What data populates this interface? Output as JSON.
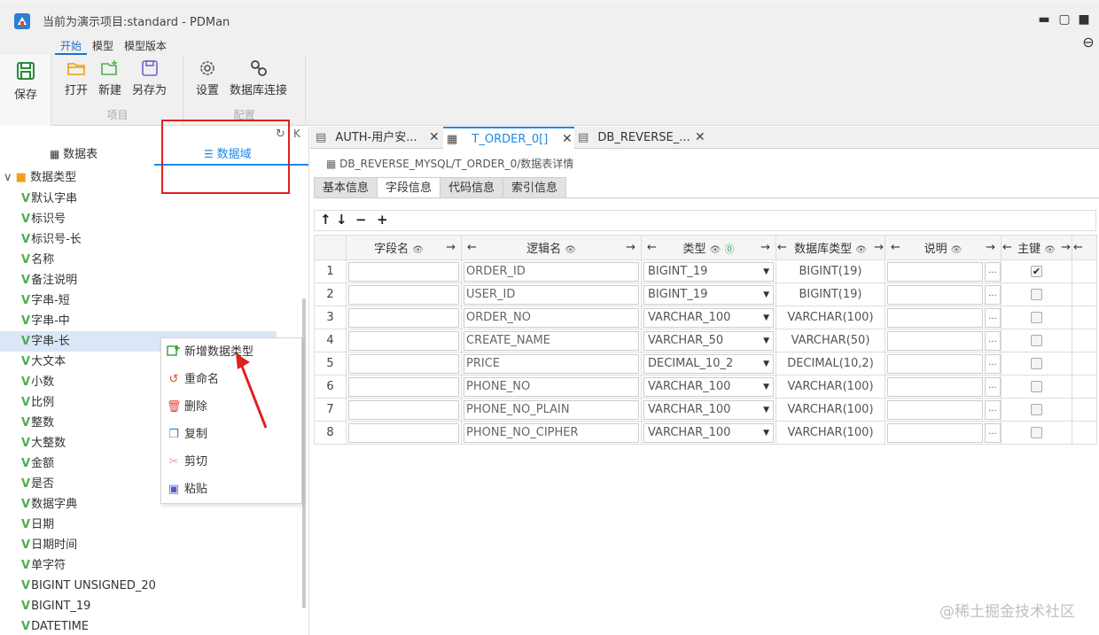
{
  "window": {
    "title": "当前为演示项目:standard - PDMan",
    "minimize": "▬",
    "maximize": "▢",
    "close": "■",
    "logout": "⊖"
  },
  "ribbon": {
    "tabs": [
      {
        "label": "开始",
        "active": true
      },
      {
        "label": "模型"
      },
      {
        "label": "模型版本"
      }
    ],
    "save": {
      "label": "保存",
      "icon": "save-icon"
    },
    "project_group": {
      "label": "项目",
      "buttons": [
        {
          "label": "打开",
          "icon": "folder-open-icon"
        },
        {
          "label": "新建",
          "icon": "new-file-icon"
        },
        {
          "label": "另存为",
          "icon": "save-as-icon"
        }
      ]
    },
    "config_group": {
      "label": "配置",
      "buttons": [
        {
          "label": "设置",
          "icon": "gear-icon"
        },
        {
          "label": "数据库连接",
          "icon": "link-icon"
        }
      ]
    }
  },
  "left_panel": {
    "tabs": [
      {
        "label": "数据表",
        "icon": "grid-icon"
      },
      {
        "label": "数据域",
        "icon": "list-icon",
        "active": true
      }
    ],
    "tree_root": "数据类型",
    "tree_items": [
      "默认字串",
      "标识号",
      "标识号-长",
      "名称",
      "备注说明",
      "字串-短",
      "字串-中",
      "字串-长",
      "大文本",
      "小数",
      "比例",
      "整数",
      "大整数",
      "金额",
      "是否",
      "数据字典",
      "日期",
      "日期时间",
      "单字符",
      "BIGINT UNSIGNED_20",
      "BIGINT_19",
      "DATETIME"
    ],
    "selected_index": 7
  },
  "context_menu": {
    "items": [
      {
        "label": "新增数据类型",
        "icon": "add-icon",
        "color": "#3a9a3a"
      },
      {
        "label": "重命名",
        "icon": "rename-icon",
        "color": "#e8501e"
      },
      {
        "label": "删除",
        "icon": "trash-icon",
        "color": "#e04040"
      },
      {
        "label": "复制",
        "icon": "copy-icon",
        "color": "#2d7fd3"
      },
      {
        "label": "剪切",
        "icon": "scissors-icon",
        "color": "#e6a0a0"
      },
      {
        "label": "粘贴",
        "icon": "paste-icon",
        "color": "#5a5ad0"
      }
    ]
  },
  "editor": {
    "tabs": [
      {
        "label": "AUTH-用户安...",
        "icon": "doc-icon"
      },
      {
        "label": "T_ORDER_0[]",
        "icon": "grid-icon",
        "active": true
      },
      {
        "label": "DB_REVERSE_...",
        "icon": "doc-icon"
      }
    ],
    "breadcrumb": "DB_REVERSE_MYSQL/T_ORDER_0/数据表详情",
    "subtabs": [
      {
        "label": "基本信息"
      },
      {
        "label": "字段信息",
        "active": true
      },
      {
        "label": "代码信息"
      },
      {
        "label": "索引信息"
      }
    ],
    "toolbar": [
      "↑",
      "↓",
      "−",
      "+"
    ],
    "columns": [
      "字段名",
      "逻辑名",
      "类型",
      "数据库类型",
      "说明",
      "主键"
    ],
    "rows": [
      {
        "num": "1",
        "name": "",
        "logic": "ORDER_ID",
        "type": "BIGINT_19",
        "dbtype": "BIGINT(19)",
        "desc": "",
        "pk": true
      },
      {
        "num": "2",
        "name": "",
        "logic": "USER_ID",
        "type": "BIGINT_19",
        "dbtype": "BIGINT(19)",
        "desc": "",
        "pk": false
      },
      {
        "num": "3",
        "name": "",
        "logic": "ORDER_NO",
        "type": "VARCHAR_100",
        "dbtype": "VARCHAR(100)",
        "desc": "",
        "pk": false
      },
      {
        "num": "4",
        "name": "",
        "logic": "CREATE_NAME",
        "type": "VARCHAR_50",
        "dbtype": "VARCHAR(50)",
        "desc": "",
        "pk": false
      },
      {
        "num": "5",
        "name": "",
        "logic": "PRICE",
        "type": "DECIMAL_10_2",
        "dbtype": "DECIMAL(10,2)",
        "desc": "",
        "pk": false
      },
      {
        "num": "6",
        "name": "",
        "logic": "PHONE_NO",
        "type": "VARCHAR_100",
        "dbtype": "VARCHAR(100)",
        "desc": "",
        "pk": false
      },
      {
        "num": "7",
        "name": "",
        "logic": "PHONE_NO_PLAIN",
        "type": "VARCHAR_100",
        "dbtype": "VARCHAR(100)",
        "desc": "",
        "pk": false
      },
      {
        "num": "8",
        "name": "",
        "logic": "PHONE_NO_CIPHER",
        "type": "VARCHAR_100",
        "dbtype": "VARCHAR(100)",
        "desc": "",
        "pk": false
      }
    ]
  },
  "watermark": "@稀土掘金技术社区",
  "colors": {
    "accent": "#1e88e5",
    "annotation": "#e02020"
  }
}
